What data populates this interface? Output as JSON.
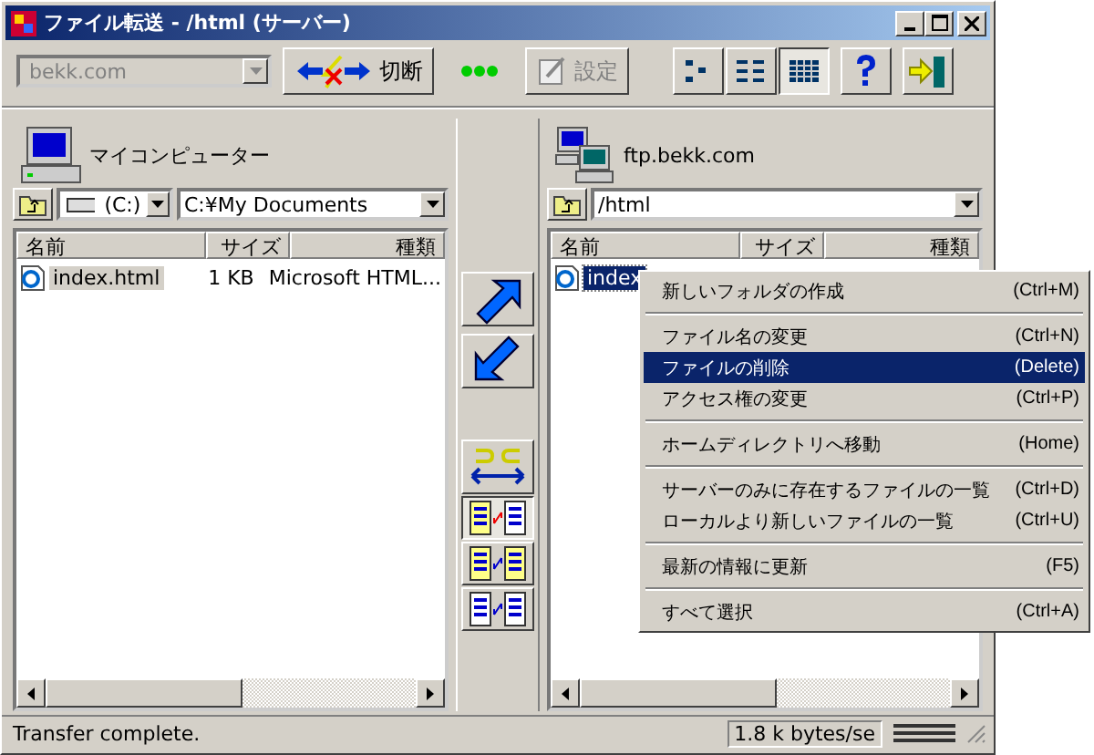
{
  "window": {
    "title": "ファイル転送 - /html (サーバー)"
  },
  "toolbar": {
    "host": {
      "value": "bekk.com",
      "disabled": true
    },
    "disconnect": {
      "label": "切断"
    },
    "settings": {
      "label": "設定",
      "disabled": true
    },
    "views": [
      {
        "kind": "large",
        "selected": false
      },
      {
        "kind": "list",
        "selected": false
      },
      {
        "kind": "details",
        "selected": true
      }
    ]
  },
  "local": {
    "label": "マイコンピューター",
    "drive": "(C:)",
    "path": "C:¥My Documents",
    "columns": [
      "名前",
      "サイズ",
      "種類"
    ],
    "rows": [
      {
        "name": "index.html",
        "size": "1 KB",
        "type": "Microsoft HTML...",
        "selected": true
      }
    ]
  },
  "remote": {
    "label": "ftp.bekk.com",
    "path": "/html",
    "columns": [
      "名前",
      "サイズ",
      "種類"
    ],
    "rows": [
      {
        "name": "index",
        "selected": true
      }
    ]
  },
  "compare_buttons": [
    {
      "kind": "swap",
      "selected": false
    },
    {
      "kind": "sync",
      "selected": true
    },
    {
      "kind": "binary",
      "selected": false
    },
    {
      "kind": "text",
      "selected": false
    }
  ],
  "context_menu": [
    {
      "kind": "item",
      "label": "新しいフォルダの作成",
      "shortcut": "(Ctrl+M)",
      "selected": false
    },
    {
      "kind": "separator"
    },
    {
      "kind": "item",
      "label": "ファイル名の変更",
      "shortcut": "(Ctrl+N)",
      "selected": false
    },
    {
      "kind": "item",
      "label": "ファイルの削除",
      "shortcut": "(Delete)",
      "selected": true
    },
    {
      "kind": "item",
      "label": "アクセス権の変更",
      "shortcut": "(Ctrl+P)",
      "selected": false
    },
    {
      "kind": "separator"
    },
    {
      "kind": "item",
      "label": "ホームディレクトリへ移動",
      "shortcut": "(Home)",
      "selected": false
    },
    {
      "kind": "separator"
    },
    {
      "kind": "item",
      "label": "サーバーのみに存在するファイルの一覧",
      "shortcut": "(Ctrl+D)",
      "selected": false
    },
    {
      "kind": "item",
      "label": "ローカルより新しいファイルの一覧",
      "shortcut": "(Ctrl+U)",
      "selected": false
    },
    {
      "kind": "separator"
    },
    {
      "kind": "item",
      "label": "最新の情報に更新",
      "shortcut": "(F5)",
      "selected": false
    },
    {
      "kind": "separator"
    },
    {
      "kind": "item",
      "label": "すべて選択",
      "shortcut": "(Ctrl+A)",
      "selected": false
    }
  ],
  "status_bar": {
    "message": "Transfer complete.",
    "speed": "1.8 k bytes/se"
  }
}
